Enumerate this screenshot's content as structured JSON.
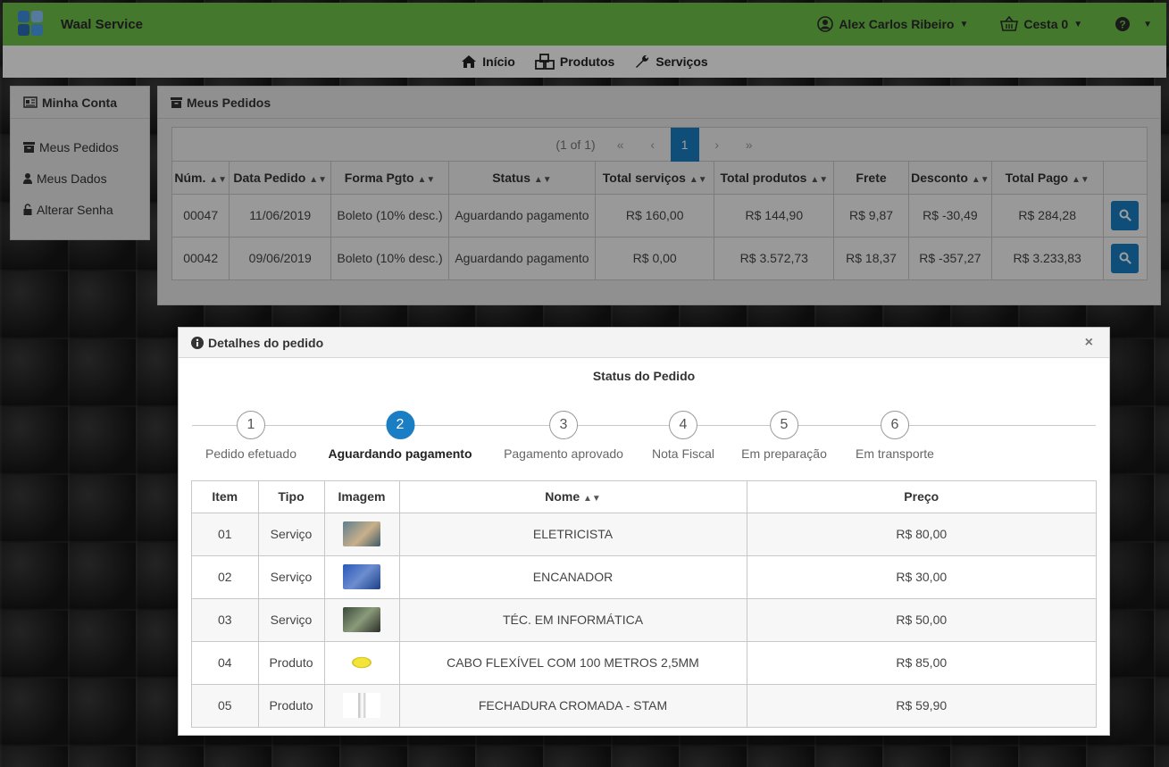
{
  "app": {
    "title": "Waal Service"
  },
  "header": {
    "user": "Alex Carlos Ribeiro",
    "cart": "Cesta 0"
  },
  "nav": {
    "home": "Início",
    "products": "Produtos",
    "services": "Serviços"
  },
  "account": {
    "title": "Minha Conta",
    "items": [
      {
        "label": "Meus Pedidos",
        "icon": "archive-icon"
      },
      {
        "label": "Meus Dados",
        "icon": "user-icon"
      },
      {
        "label": "Alterar Senha",
        "icon": "unlock-icon"
      }
    ]
  },
  "orders": {
    "title": "Meus Pedidos",
    "pagination": {
      "summary": "(1 of 1)",
      "current_page": "1"
    },
    "columns": [
      "Núm.",
      "Data Pedido",
      "Forma Pgto",
      "Status",
      "Total serviços",
      "Total produtos",
      "Frete",
      "Desconto",
      "Total Pago"
    ],
    "rows": [
      [
        "00047",
        "11/06/2019",
        "Boleto (10% desc.)",
        "Aguardando pagamento",
        "R$ 160,00",
        "R$ 144,90",
        "R$ 9,87",
        "R$ -30,49",
        "R$ 284,28"
      ],
      [
        "00042",
        "09/06/2019",
        "Boleto (10% desc.)",
        "Aguardando pagamento",
        "R$ 0,00",
        "R$ 3.572,73",
        "R$ 18,37",
        "R$ -357,27",
        "R$ 3.233,83"
      ]
    ]
  },
  "modal": {
    "title": "Detalhes do pedido",
    "close_symbol": "×",
    "subtitle": "Status do Pedido",
    "steps": [
      {
        "num": "1",
        "label": "Pedido efetuado"
      },
      {
        "num": "2",
        "label": "Aguardando pagamento"
      },
      {
        "num": "3",
        "label": "Pagamento aprovado"
      },
      {
        "num": "4",
        "label": "Nota Fiscal"
      },
      {
        "num": "5",
        "label": "Em preparação"
      },
      {
        "num": "6",
        "label": "Em transporte"
      }
    ],
    "active_step": 2,
    "item_columns": [
      "Item",
      "Tipo",
      "Imagem",
      "Nome",
      "Preço"
    ],
    "items": [
      {
        "item": "01",
        "tipo": "Serviço",
        "nome": "ELETRICISTA",
        "preco": "R$ 80,00"
      },
      {
        "item": "02",
        "tipo": "Serviço",
        "nome": "ENCANADOR",
        "preco": "R$ 30,00"
      },
      {
        "item": "03",
        "tipo": "Serviço",
        "nome": "TÉC. EM INFORMÁTICA",
        "preco": "R$ 50,00"
      },
      {
        "item": "04",
        "tipo": "Produto",
        "nome": "CABO FLEXÍVEL COM 100 METROS 2,5MM",
        "preco": "R$ 85,00"
      },
      {
        "item": "05",
        "tipo": "Produto",
        "nome": "FECHADURA CROMADA - STAM",
        "preco": "R$ 59,90"
      }
    ]
  },
  "colors": {
    "header_green": "#6cc24a",
    "accent_blue": "#1a7ec5"
  }
}
